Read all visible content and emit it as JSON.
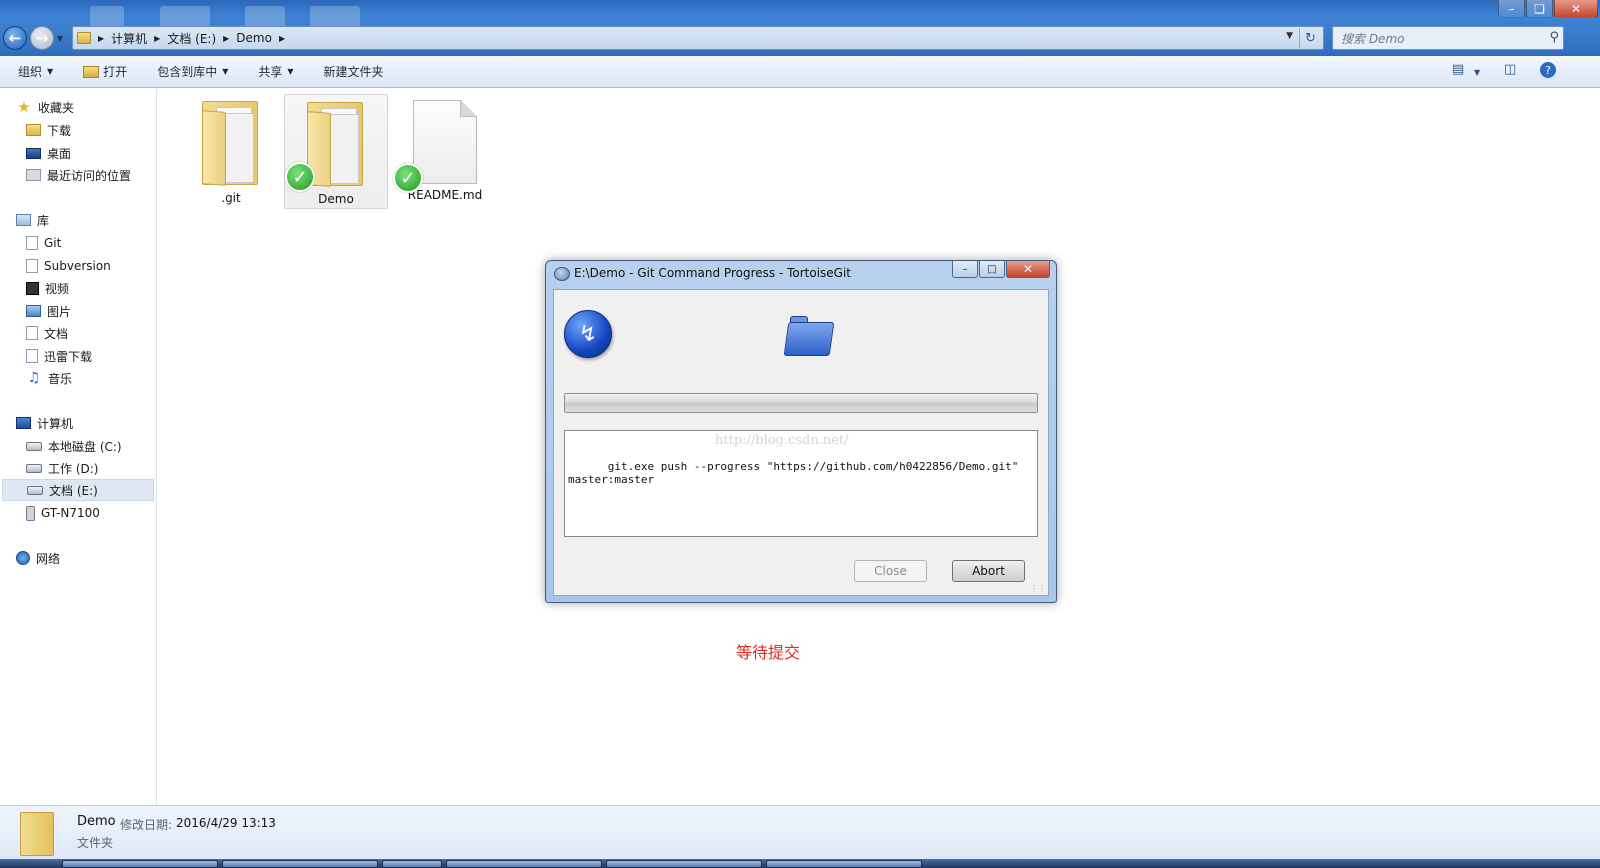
{
  "address": {
    "crumbs": [
      "计算机",
      "文档 (E:)",
      "Demo"
    ],
    "search_placeholder": "搜索 Demo"
  },
  "toolbar": {
    "organize": "组织",
    "open": "打开",
    "include_in_library": "包含到库中",
    "share": "共享",
    "new_folder": "新建文件夹"
  },
  "nav": {
    "favorites": {
      "label": "收藏夹",
      "items": [
        "下载",
        "桌面",
        "最近访问的位置"
      ]
    },
    "libraries": {
      "label": "库",
      "items": [
        "Git",
        "Subversion",
        "视频",
        "图片",
        "文档",
        "迅雷下载",
        "音乐"
      ]
    },
    "computer": {
      "label": "计算机",
      "items": [
        "本地磁盘 (C:)",
        "工作 (D:)",
        "文档 (E:)",
        "GT-N7100"
      ],
      "selected": "文档 (E:)"
    },
    "network": {
      "label": "网络"
    }
  },
  "files": [
    {
      "name": ".git",
      "type": "folder",
      "synced": false
    },
    {
      "name": "Demo",
      "type": "folder",
      "synced": true,
      "selected": true
    },
    {
      "name": "README.md",
      "type": "file",
      "synced": true
    }
  ],
  "dialog": {
    "title": "E:\\Demo - Git Command Progress - TortoiseGit",
    "progress": 0,
    "log": "git.exe push --progress \"https://github.com/h0422856/Demo.git\"\nmaster:master",
    "watermark": "http://blog.csdn.net/",
    "close_label": "Close",
    "close_enabled": false,
    "abort_label": "Abort"
  },
  "annotation": "等待提交",
  "details": {
    "name": "Demo",
    "modified_label": "修改日期:",
    "modified_value": "2016/4/29 13:13",
    "type": "文件夹"
  },
  "colors": {
    "annotation": "#e02b1f",
    "titlebar": "#3b7bcb",
    "ok_badge": "#1f9a24"
  }
}
